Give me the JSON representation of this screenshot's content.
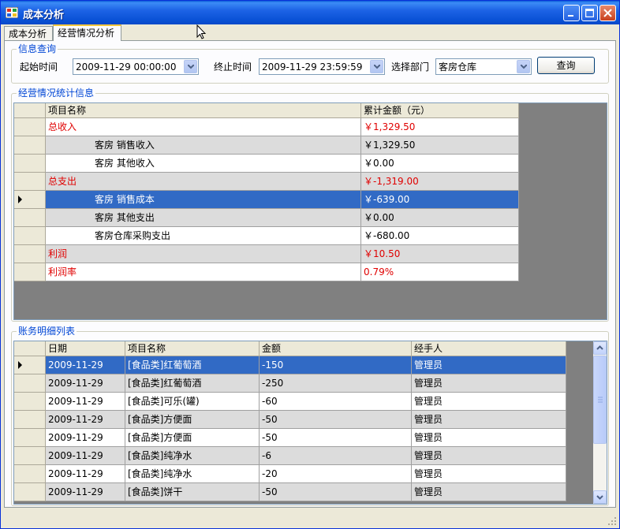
{
  "window": {
    "title": "成本分析",
    "colors": {
      "titlebar": "#0a52d6",
      "accent_red": "#e00000",
      "selection": "#316ac5",
      "group_title": "#0046d5"
    }
  },
  "tabs": [
    {
      "label": "成本分析",
      "active": false
    },
    {
      "label": "经营情况分析",
      "active": true
    }
  ],
  "query": {
    "group_title": "信息查询",
    "start_label": "起始时间",
    "start_value": "2009-11-29 00:00:00",
    "end_label": "终止时间",
    "end_value": "2009-11-29 23:59:59",
    "dept_label": "选择部门",
    "dept_value": "客房仓库",
    "query_button": "查询"
  },
  "stats": {
    "group_title": "经营情况统计信息",
    "columns": [
      "项目名称",
      "累计金额（元）"
    ],
    "rows": [
      {
        "name": "总收入",
        "amount": "￥1,329.50",
        "indent": false,
        "red": true,
        "shade": false,
        "selected": false
      },
      {
        "name": "客房 销售收入",
        "amount": "￥1,329.50",
        "indent": true,
        "red": false,
        "shade": true,
        "selected": false
      },
      {
        "name": "客房 其他收入",
        "amount": "￥0.00",
        "indent": true,
        "red": false,
        "shade": false,
        "selected": false
      },
      {
        "name": "总支出",
        "amount": "￥-1,319.00",
        "indent": false,
        "red": true,
        "shade": true,
        "selected": false
      },
      {
        "name": "客房 销售成本",
        "amount": "￥-639.00",
        "indent": true,
        "red": false,
        "shade": false,
        "selected": true
      },
      {
        "name": "客房 其他支出",
        "amount": "￥0.00",
        "indent": true,
        "red": false,
        "shade": true,
        "selected": false
      },
      {
        "name": "客房仓库采购支出",
        "amount": "￥-680.00",
        "indent": true,
        "red": false,
        "shade": false,
        "selected": false
      },
      {
        "name": "利润",
        "amount": "￥10.50",
        "indent": false,
        "red": true,
        "shade": true,
        "selected": false
      },
      {
        "name": "利润率",
        "amount": "0.79%",
        "indent": false,
        "red": true,
        "shade": false,
        "selected": false
      }
    ]
  },
  "ledger": {
    "group_title": "账务明细列表",
    "columns": [
      "日期",
      "项目名称",
      "金额",
      "经手人"
    ],
    "rows": [
      {
        "date": "2009-11-29",
        "item": "[食品类]红葡萄酒",
        "amount": "-150",
        "handler": "管理员",
        "selected": true
      },
      {
        "date": "2009-11-29",
        "item": "[食品类]红葡萄酒",
        "amount": "-250",
        "handler": "管理员",
        "selected": false
      },
      {
        "date": "2009-11-29",
        "item": "[食品类]可乐(罐)",
        "amount": "-60",
        "handler": "管理员",
        "selected": false
      },
      {
        "date": "2009-11-29",
        "item": "[食品类]方便面",
        "amount": "-50",
        "handler": "管理员",
        "selected": false
      },
      {
        "date": "2009-11-29",
        "item": "[食品类]方便面",
        "amount": "-50",
        "handler": "管理员",
        "selected": false
      },
      {
        "date": "2009-11-29",
        "item": "[食品类]纯净水",
        "amount": "-6",
        "handler": "管理员",
        "selected": false
      },
      {
        "date": "2009-11-29",
        "item": "[食品类]纯净水",
        "amount": "-20",
        "handler": "管理员",
        "selected": false
      },
      {
        "date": "2009-11-29",
        "item": "[食品类]饼干",
        "amount": "-50",
        "handler": "管理员",
        "selected": false
      }
    ]
  }
}
